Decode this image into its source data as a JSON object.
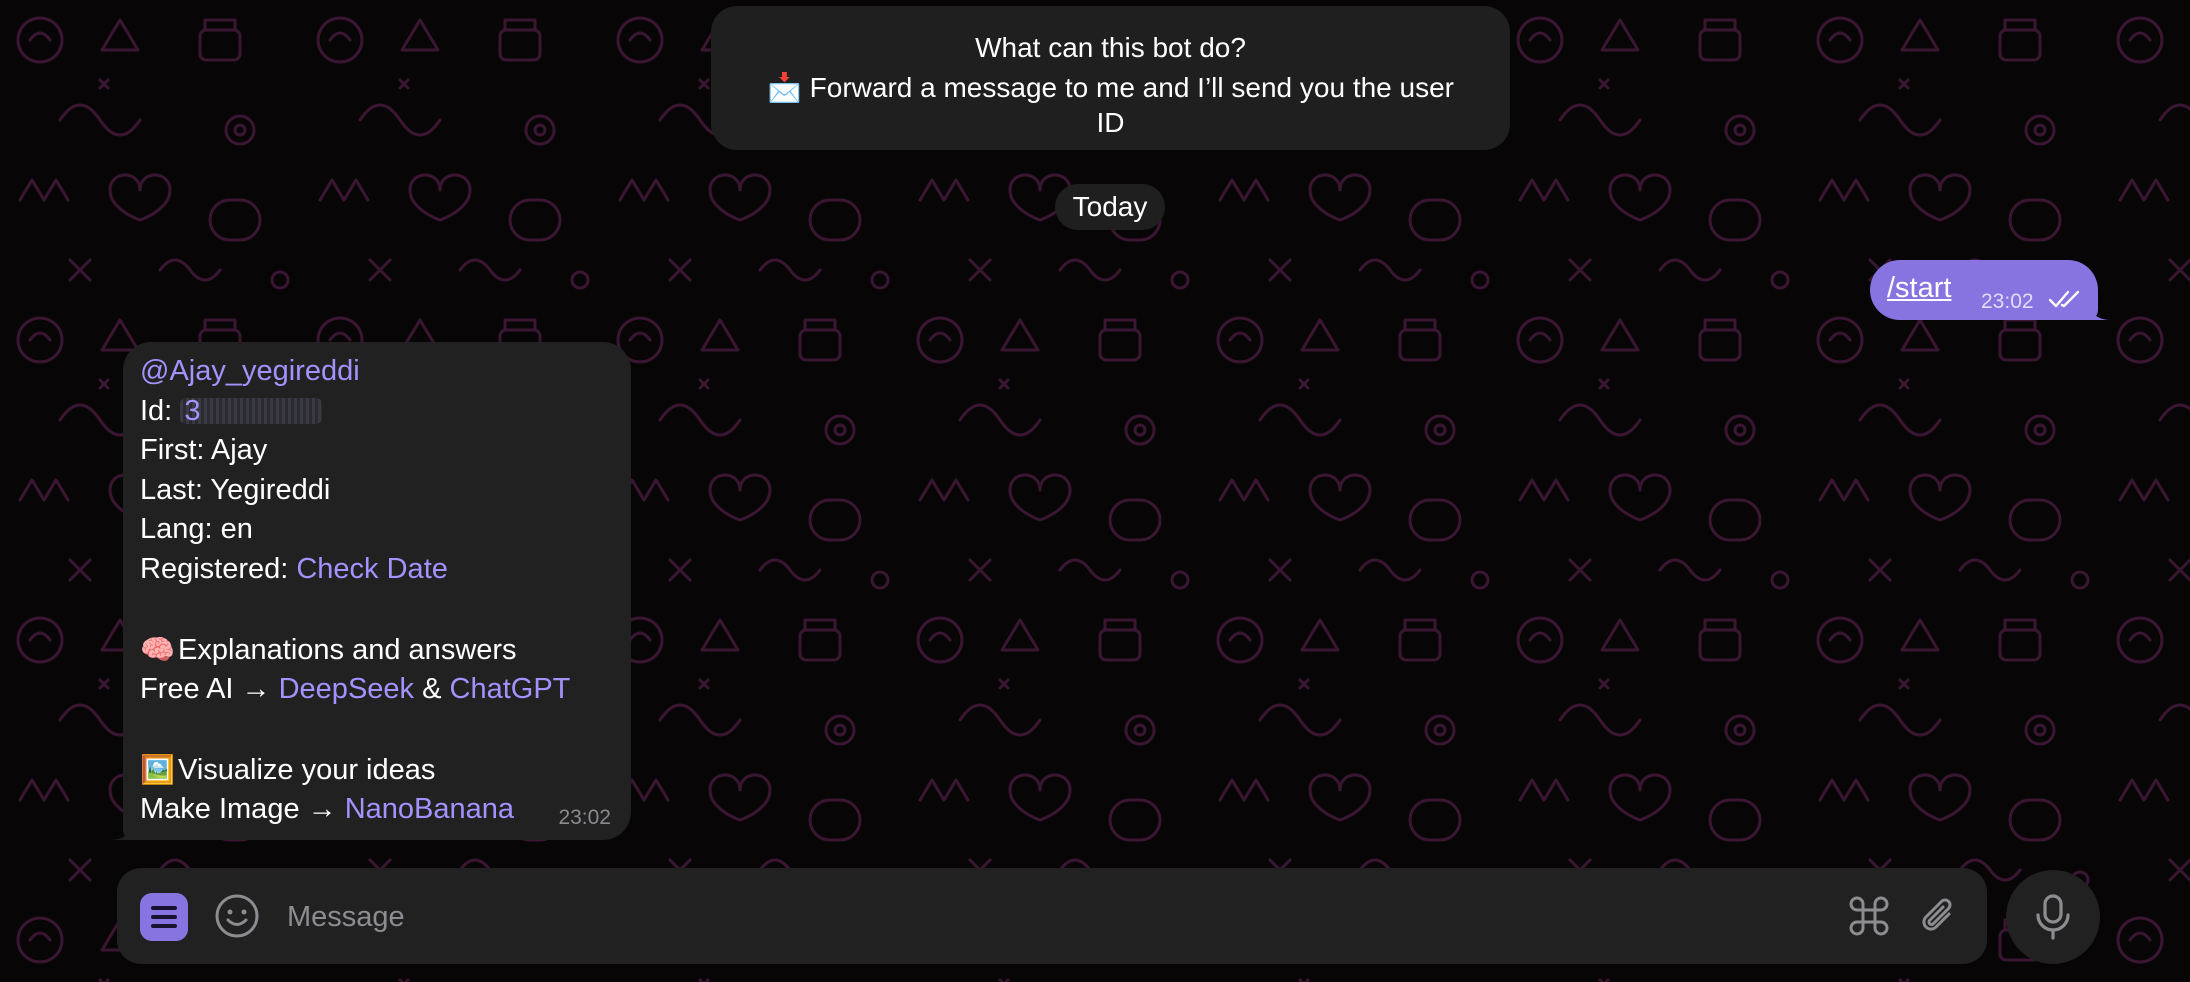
{
  "bot_info": {
    "title": "What can this bot do?",
    "icon": "📩",
    "description": "Forward a message to me and I’ll send you the user ID"
  },
  "date_chip": "Today",
  "outgoing": {
    "text": "/start",
    "time": "23:02",
    "status_icon": "double-check-icon"
  },
  "incoming": {
    "username": "@Ajay_yegireddi",
    "id_label": "Id: ",
    "id_value_visible": "3",
    "first": "First: Ajay",
    "last": "Last: Yegireddi",
    "lang": "Lang: en",
    "registered_label": "Registered: ",
    "registered_link": "Check Date",
    "section1_emoji": "🧠",
    "section1_title": "Explanations and answers",
    "ai_prefix": "Free AI → ",
    "ai_link1": "DeepSeek",
    "ai_amp": " & ",
    "ai_link2": "ChatGPT",
    "section2_emoji": "🖼️",
    "section2_title": "Visualize your ideas",
    "image_prefix": "Make Image → ",
    "image_link": "NanoBanana",
    "time": "23:02"
  },
  "composer": {
    "placeholder": "Message",
    "value": ""
  },
  "colors": {
    "accent": "#8774e1",
    "link": "#a392ff",
    "bubble": "#212121",
    "background": "#070506",
    "pattern": "#3a1633"
  }
}
